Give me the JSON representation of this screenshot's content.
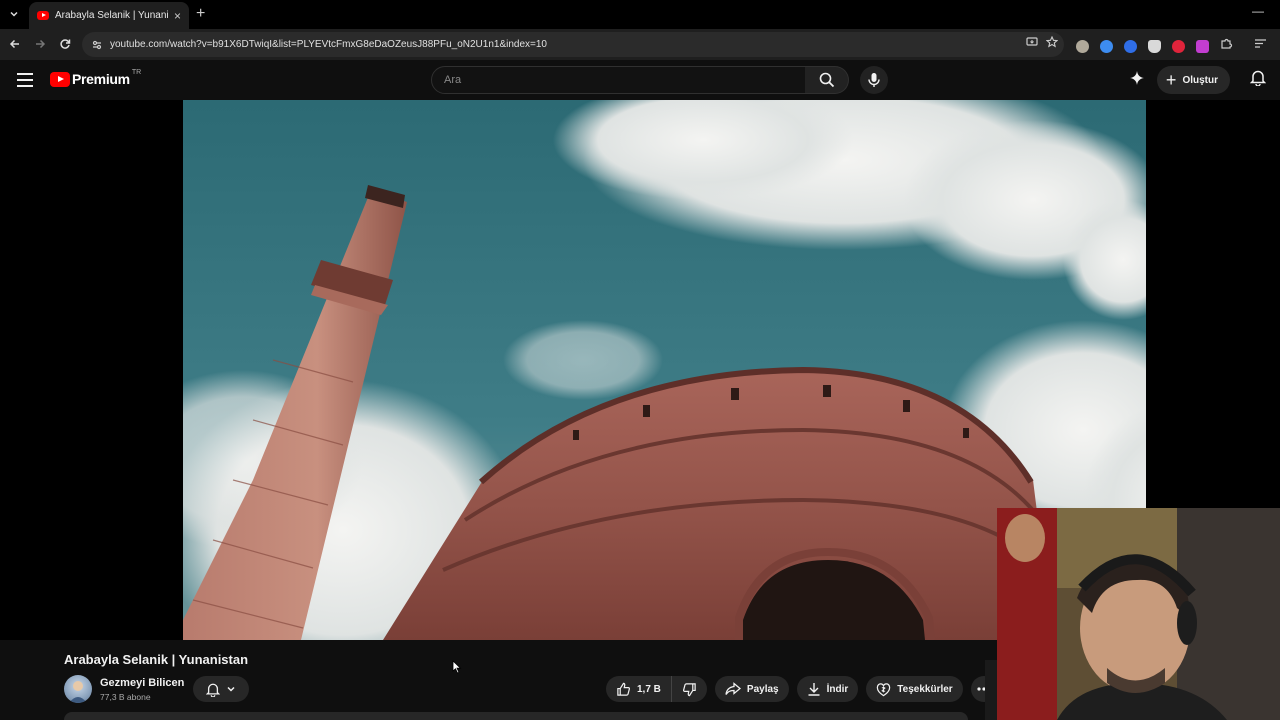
{
  "browser": {
    "tab_title": "Arabayla Selanik | Yunanistan -",
    "url": "youtube.com/watch?v=b91X6DTwiqI&list=PLYEVtcFmxG8eDaOZeusJ88PFu_oN2U1n1&index=10",
    "close_glyph": "×",
    "new_tab_glyph": "+",
    "minimize_glyph": "—",
    "extension_colors": [
      "#b0a99a",
      "#3d8cf0",
      "#2f6ee8",
      "#d9d9d9",
      "#e0243b",
      "#c23dd0"
    ]
  },
  "header": {
    "logo_text": "Premium",
    "region": "TR",
    "search_placeholder": "Ara",
    "create_label": "Oluştur"
  },
  "video": {
    "title": "Arabayla Selanik | Yunanistan",
    "channel_name": "Gezmeyi Bilicen",
    "subscribers": "77,3 B abone",
    "like_count": "1,7 B",
    "share_label": "Paylaş",
    "download_label": "İndir",
    "thanks_label": "Teşekkürler"
  }
}
